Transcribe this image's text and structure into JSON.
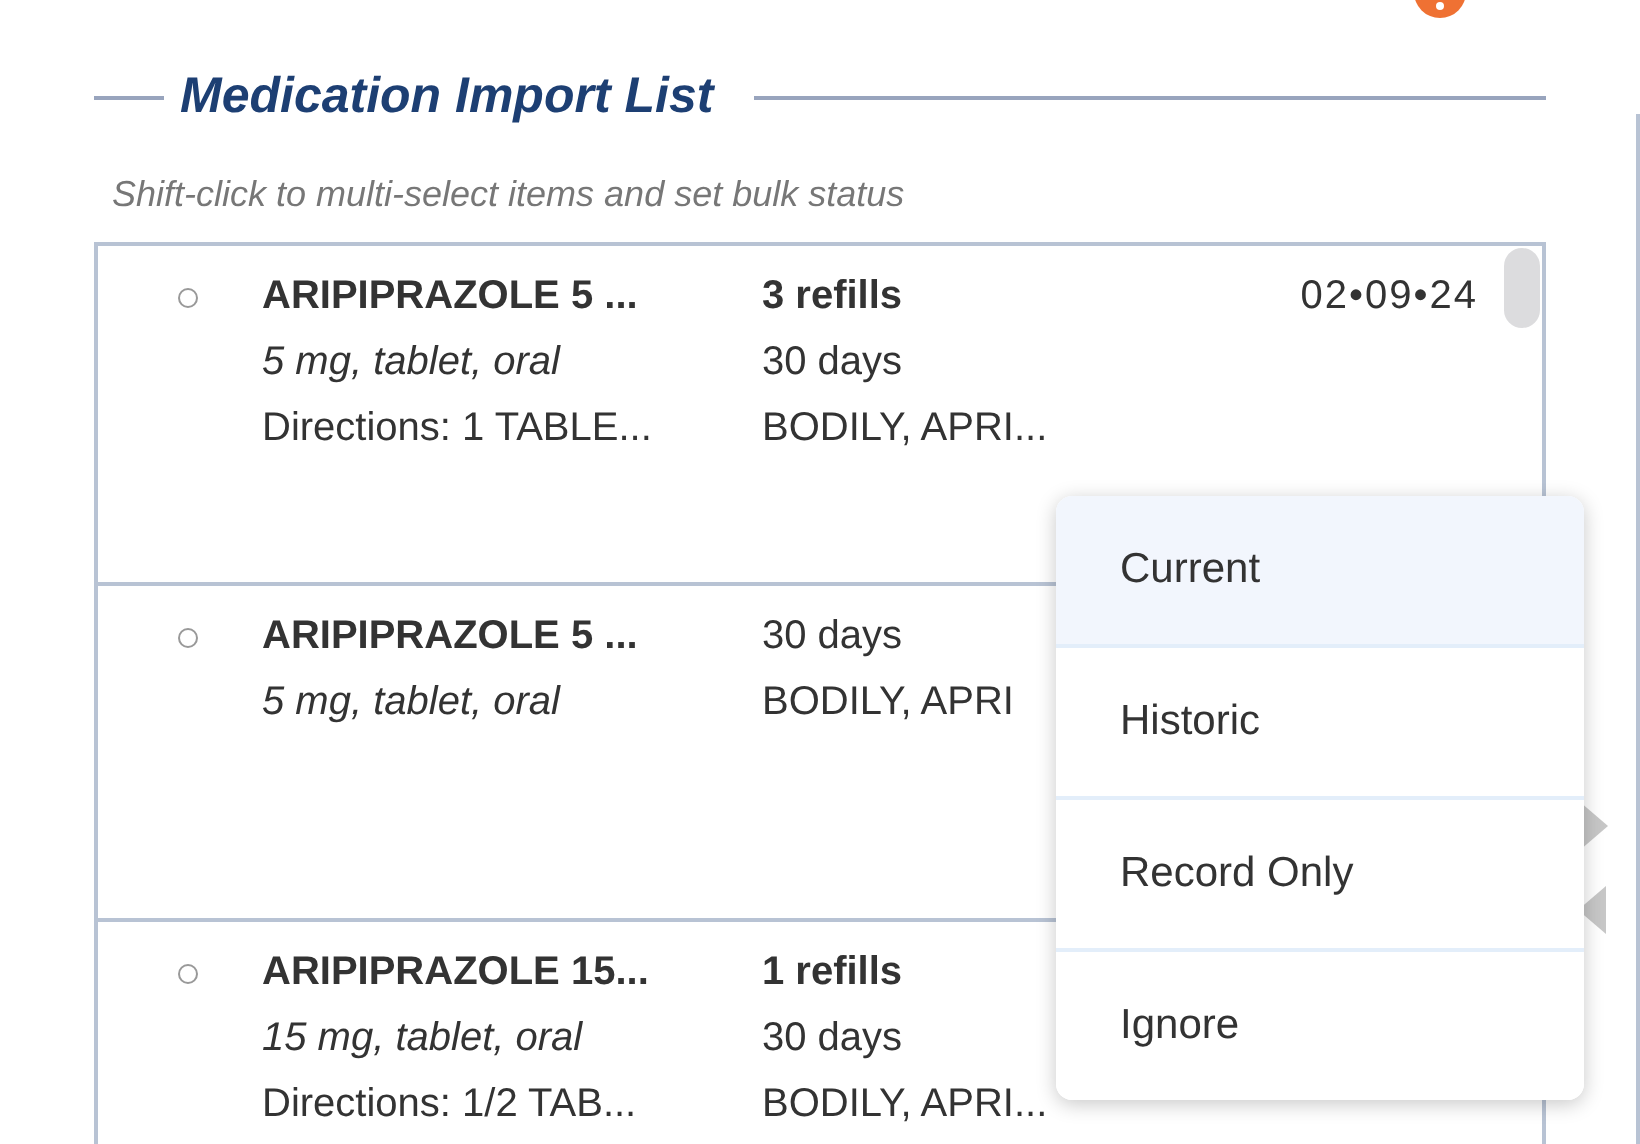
{
  "section": {
    "title": "Medication Import List",
    "hint": "Shift-click to multi-select items and set bulk status"
  },
  "medications": [
    {
      "name": "ARIPIPRAZOLE 5 ...",
      "form": "5 mg, tablet, oral",
      "directions": "Directions: 1 TABLE...",
      "refills": "3 refills",
      "supply": "30 days",
      "route": "BODILY, APRI...",
      "date": "02•09•24",
      "checked": false
    },
    {
      "name": "ARIPIPRAZOLE 5 ...",
      "form": "5 mg, tablet, oral",
      "supply": "30 days",
      "route": "BODILY, APRI",
      "checked": false
    },
    {
      "name": "ARIPIPRAZOLE 15...",
      "form": "15 mg, tablet, oral",
      "directions": "Directions: 1/2 TAB...",
      "refills": "1 refills",
      "supply": "30 days",
      "route": "BODILY, APRI...",
      "checked": false
    }
  ],
  "status_menu": [
    {
      "label": "Current",
      "selected": true
    },
    {
      "label": "Historic",
      "selected": false
    },
    {
      "label": "Record Only",
      "selected": false
    },
    {
      "label": "Ignore",
      "selected": false
    }
  ]
}
